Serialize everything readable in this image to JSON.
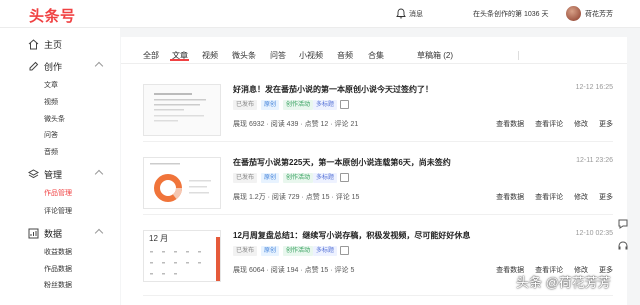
{
  "header": {
    "logo": "头条号",
    "messages_label": "消息",
    "creation_days": "在头条创作的第 1036 天",
    "username": "荷花芳芳"
  },
  "sidebar": {
    "home": "主页",
    "sections": [
      {
        "label": "创作",
        "icon": "edit-icon",
        "items": [
          "文章",
          "视频",
          "微头条",
          "问答",
          "音频"
        ]
      },
      {
        "label": "管理",
        "icon": "layers-icon",
        "items": [
          "作品管理",
          "评论管理"
        ]
      },
      {
        "label": "数据",
        "icon": "chart-icon",
        "items": [
          "收益数据",
          "作品数据",
          "粉丝数据"
        ]
      }
    ],
    "active_item": "作品管理"
  },
  "tabs": [
    "全部",
    "文章",
    "视频",
    "微头条",
    "问答",
    "小视频",
    "音频",
    "合集",
    "草稿箱 (2)"
  ],
  "active_tab": "文章",
  "articles": [
    {
      "title": "好消息！发在番茄小说的第一本原创小说今天过签约了！",
      "date": "12-12 16:25",
      "badges": [
        "已发布",
        "原创",
        "创作活动",
        "多标题"
      ],
      "stats": "展现 6932 · 阅读 439 · 点赞 12 · 评论 21",
      "actions": [
        "查看数据",
        "查看评论",
        "修改",
        "更多"
      ]
    },
    {
      "title": "在番茄写小说第225天，第一本原创小说连载第6天，尚未签约",
      "date": "12-11 23:26",
      "badges": [
        "已发布",
        "原创",
        "创作活动",
        "多标题"
      ],
      "stats": "展现 1.2万 · 阅读 729 · 点赞 15 · 评论 15",
      "actions": [
        "查看数据",
        "查看评论",
        "修改",
        "更多"
      ]
    },
    {
      "title": "12月周复盘总结1：继续写小说存稿，积极发视频，尽可能好好休息",
      "date": "12-10 02:35",
      "badges": [
        "已发布",
        "原创",
        "创作活动",
        "多标题"
      ],
      "stats": "展现 6064 · 阅读 194 · 点赞 15 · 评论 5",
      "actions": [
        "查看数据",
        "查看评论",
        "修改",
        "更多"
      ]
    }
  ],
  "thumb3_text": "12 月",
  "watermark": "头条 @荷花芳芳",
  "colors": {
    "brand": "#f04142",
    "accent_orange": "#f0743a"
  }
}
